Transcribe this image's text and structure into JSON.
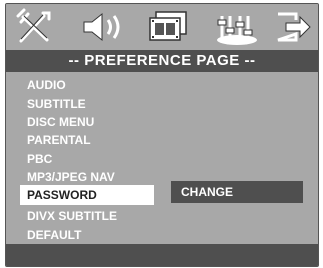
{
  "header": {
    "title": "-- PREFERENCE PAGE --",
    "icons": [
      {
        "name": "general-setup-icon"
      },
      {
        "name": "audio-setup-icon"
      },
      {
        "name": "video-setup-icon"
      },
      {
        "name": "preference-setup-icon",
        "active": true
      },
      {
        "name": "exit-icon"
      }
    ]
  },
  "menu": {
    "items": [
      {
        "label": "AUDIO"
      },
      {
        "label": "SUBTITLE"
      },
      {
        "label": "DISC MENU"
      },
      {
        "label": "PARENTAL"
      },
      {
        "label": "PBC"
      },
      {
        "label": "MP3/JPEG NAV"
      },
      {
        "label": "PASSWORD",
        "selected": true
      },
      {
        "label": "DIVX SUBTITLE"
      },
      {
        "label": "DEFAULT"
      }
    ]
  },
  "submenu": {
    "option": "CHANGE"
  },
  "colors": {
    "screen_bg": "#a8a8a8",
    "bar_bg": "#4f4f4f",
    "highlight_bg": "#ffffff",
    "text": "#ffffff"
  }
}
